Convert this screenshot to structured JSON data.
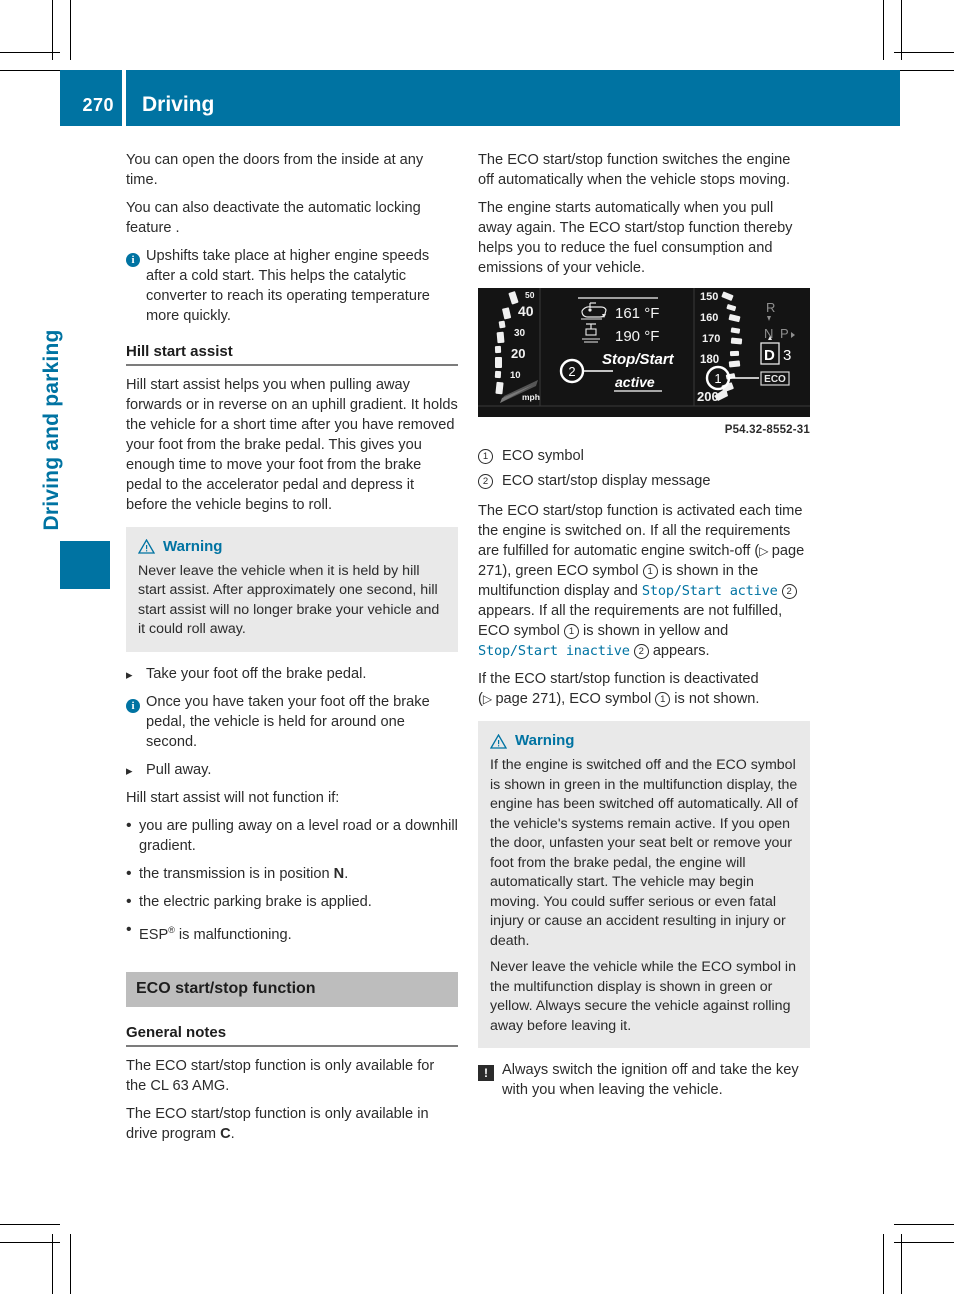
{
  "header": {
    "page_number": "270",
    "chapter_title": "Driving",
    "side_tab": "Driving and parking"
  },
  "left_column": {
    "para_doors": "You can open the doors from the inside at any time.",
    "para_locking": "You can also deactivate the automatic locking feature .",
    "info_upshifts": "Upshifts take place at higher engine speeds after a cold start. This helps the catalytic converter to reach its operating temperature more quickly.",
    "heading_hill_start": "Hill start assist",
    "para_hill_start": "Hill start assist helps you when pulling away forwards or in reverse on an uphill gradient. It holds the vehicle for a short time after you have removed your foot from the brake pedal. This gives you enough time to move your foot from the brake pedal to the accelerator pedal and depress it before the vehicle begins to roll.",
    "warning": {
      "title": "Warning",
      "body": "Never leave the vehicle when it is held by hill start assist. After approximately one second, hill start assist will no longer brake your vehicle and it could roll away."
    },
    "step_take_foot_off": "Take your foot off the brake pedal.",
    "info_held_one_second": "Once you have taken your foot off the brake pedal, the vehicle is held for around one second.",
    "step_pull_away": "Pull away.",
    "para_will_not_function": "Hill start assist will not function if:",
    "bullets": [
      {
        "text_before": "you are pulling away on a level road or a downhill gradient.",
        "bold": "",
        "text_after": ""
      },
      {
        "text_before": "the transmission is in position ",
        "bold": "N",
        "text_after": "."
      },
      {
        "text_before": "the electric parking brake is applied.",
        "bold": "",
        "text_after": ""
      },
      {
        "text_before": "ESP",
        "bold": "",
        "text_after": " is malfunctioning.",
        "superscript": "®"
      }
    ],
    "section_bar": "ECO start/stop function",
    "heading_general_notes": "General notes",
    "para_only_cl63": "The ECO start/stop function is only available for the CL 63 AMG.",
    "para_drive_program_before": "The ECO start/stop function is only available in drive program ",
    "para_drive_program_bold": "C",
    "para_drive_program_after": "."
  },
  "right_column": {
    "para_switches_off": "The ECO start/stop function switches the engine off automatically when the vehicle stops moving.",
    "para_starts_automatically": "The engine starts automatically when you pull away again. The ECO start/stop function thereby helps you to reduce the fuel consumption and emissions of your vehicle.",
    "figure": {
      "caption": "P54.32-8552-31",
      "speedo_ticks": [
        "50",
        "40",
        "30",
        "20",
        "10"
      ],
      "speedo_unit": "mph",
      "right_ticks": [
        "150",
        "160",
        "170",
        "180",
        "200"
      ],
      "oil_temp": "161 °F",
      "coolant_temp": "190 °F",
      "message_line1": "Stop/Start",
      "message_line2": "active",
      "gear_letters": [
        "R",
        "N",
        "P"
      ],
      "gear_selected": "D",
      "gear_number": "3",
      "eco_badge": "ECO",
      "callout_1": "1",
      "callout_2": "2"
    },
    "legend": [
      {
        "num": "1",
        "label": "ECO symbol"
      },
      {
        "num": "2",
        "label": "ECO start/stop display message"
      }
    ],
    "para_activated_1": "The ECO start/stop function is activated each time the engine is switched on. If all the requirements are fulfilled for automatic engine switch-off (",
    "para_activated_page": "page 271",
    "para_activated_2": "), green ECO symbol ",
    "para_activated_3": " is shown in the multifunction display and ",
    "code_active": "Stop/Start active",
    "para_activated_4": " appears. If all the requirements are not fulfilled, ECO symbol ",
    "para_activated_5": " is shown in yellow and ",
    "code_inactive": "Stop/Start inactive",
    "para_activated_6": " appears.",
    "para_deactivated_1": "If the ECO start/stop function is deactivated (",
    "para_deactivated_page": "page 271",
    "para_deactivated_2": "), ECO symbol ",
    "para_deactivated_3": " is not shown.",
    "warning": {
      "title": "Warning",
      "body_1": "If the engine is switched off and the ECO symbol is shown in green in the multifunction display, the engine has been switched off automatically. All of the vehicle's systems remain active. If you open the door, unfasten your seat belt or remove your foot from the brake pedal, the engine will automatically start. The vehicle may begin moving. You could suffer serious or even fatal injury or cause an accident resulting in injury or death.",
      "body_2": "Never leave the vehicle while the ECO symbol in the multifunction display is shown in green or yellow. Always secure the vehicle against rolling away before leaving it."
    },
    "note_ignition": "Always switch the ignition off and take the key with you when leaving the vehicle."
  },
  "colors": {
    "brand_blue": "#0073a2",
    "section_gray": "#bdbdbd",
    "warning_gray": "#e9e9e9",
    "text": "#2b2b2b"
  }
}
